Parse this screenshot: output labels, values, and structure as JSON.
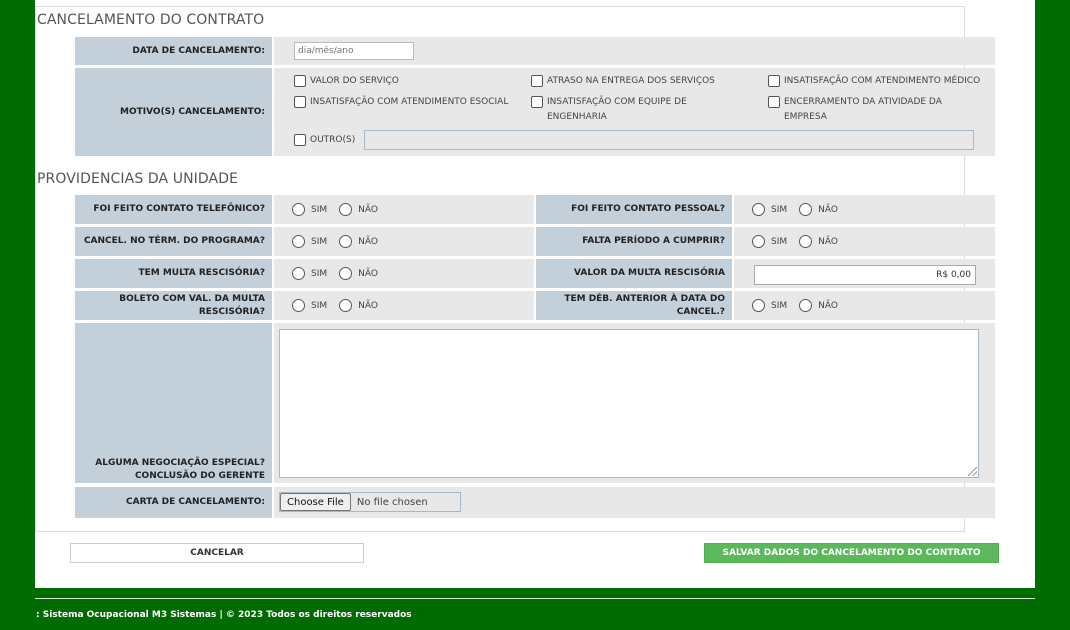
{
  "cancelamento": {
    "title": "CANCELAMENTO DO CONTRATO",
    "date_label": "DATA DE CANCELAMENTO:",
    "date_placeholder": "dia/mês/ano",
    "motivo_label": "MOTIVO(S) CANCELAMENTO:",
    "motivos": [
      "VALOR DO SERVIÇO",
      "ATRASO NA ENTREGA DOS SERVIÇOS",
      "INSATISFAÇÃO COM ATENDIMENTO MÉDICO",
      "INSATISFAÇÃO COM ATENDIMENTO ESOCIAL",
      "INSATISFAÇÃO COM EQUIPE DE ENGENHARIA",
      "ENCERRAMENTO DA ATIVIDADE DA EMPRESA"
    ],
    "outro_label": "OUTRO(S)"
  },
  "providencias": {
    "title": "PROVIDENCIAS DA UNIDADE",
    "sim": "SIM",
    "nao": "NÃO",
    "rows": [
      {
        "left": "FOI FEITO CONTATO TELEFÔNICO?",
        "right": "FOI FEITO CONTATO PESSOAL?"
      },
      {
        "left": "CANCEL. NO TÉRM. DO PROGRAMA?",
        "right": "FALTA PERÍODO A CUMPRIR?"
      },
      {
        "left": "TEM MULTA RESCISÓRIA?",
        "right": "VALOR DA MULTA RESCISÓRIA"
      },
      {
        "left": "BOLETO COM VAL. DA MULTA RESCISÓRIA?",
        "right": "TEM DÉB. ANTERIOR À DATA DO CANCEL.?"
      }
    ],
    "multa_value": "R$ 0,00",
    "negociacao_label_1": "ALGUMA NEGOCIAÇÃO ESPECIAL?",
    "negociacao_label_2": "CONCLUSÃO DO GERENTE",
    "carta_label": "CARTA DE CANCELAMENTO:",
    "file_button": "Choose File",
    "file_status": "No file chosen"
  },
  "actions": {
    "cancel": "CANCELAR",
    "save": "SALVAR DADOS DO CANCELAMENTO DO CONTRATO"
  },
  "footer": {
    "text": ": Sistema Ocupacional M3 Sistemas | © 2023 Todos os direitos reservados"
  },
  "colors": {
    "background": "#006b00",
    "label_bg": "#c3cfd9",
    "value_bg": "#e8e8e8",
    "save_button": "#5cb85c"
  }
}
